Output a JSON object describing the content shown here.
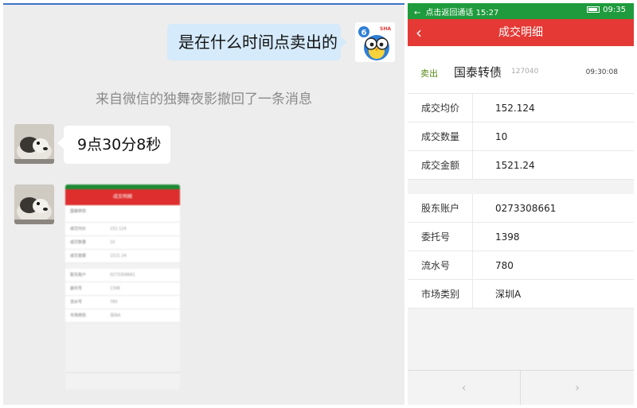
{
  "chat": {
    "sent_message": "是在什么时间点卖出的",
    "recall_notice": "来自微信的独舞夜影撤回了一条消息",
    "reply_message": "9点30分8秒",
    "my_badge": "6",
    "my_badge_tag": "SHA"
  },
  "thumbnail": {
    "title": "成交明细",
    "stock_name": "国泰转债",
    "rows_top": [
      {
        "label": "成交均价",
        "value": "152.124"
      },
      {
        "label": "成交数量",
        "value": "10"
      },
      {
        "label": "成交金额",
        "value": "1521.24"
      }
    ],
    "rows_bottom": [
      {
        "label": "股东账户",
        "value": "0273308661"
      },
      {
        "label": "委托号",
        "value": "1398"
      },
      {
        "label": "流水号",
        "value": "780"
      },
      {
        "label": "市场类别",
        "value": "深圳A"
      }
    ]
  },
  "phone": {
    "status_left": "点击返回通话 15:27",
    "status_time": "09:35",
    "title": "成交明细",
    "stock": {
      "direction": "卖出",
      "name": "国泰转债",
      "code": "127040",
      "time": "09:30:08"
    },
    "trade_rows": [
      {
        "label": "成交均价",
        "value": "152.124"
      },
      {
        "label": "成交数量",
        "value": "10"
      },
      {
        "label": "成交金额",
        "value": "1521.24"
      }
    ],
    "account_rows": [
      {
        "label": "股东账户",
        "value": "0273308661"
      },
      {
        "label": "委托号",
        "value": "1398"
      },
      {
        "label": "流水号",
        "value": "780"
      },
      {
        "label": "市场类别",
        "value": "深圳A"
      }
    ],
    "prev_label": "‹",
    "next_label": "›"
  },
  "colors": {
    "nav_red": "#e53935",
    "status_green": "#1f9b3d",
    "bubble_blue": "#d5eafb",
    "sell_green": "#5a8a1a"
  }
}
